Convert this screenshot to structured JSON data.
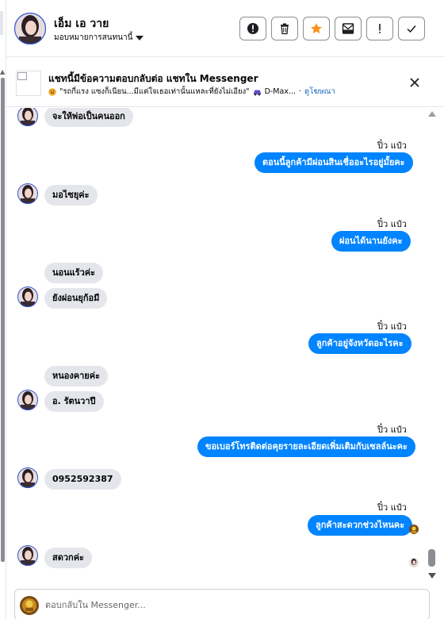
{
  "contact": {
    "name": "เอ็ม เอ วาย",
    "assign_label": "มอบหมายการสนทนานี้"
  },
  "toolbar": {
    "buttons": [
      {
        "icon": "alert-circle-icon",
        "name": "mark-spam-button"
      },
      {
        "icon": "trash-icon",
        "name": "delete-button"
      },
      {
        "icon": "star-icon",
        "name": "star-button",
        "color": "#f7931e"
      },
      {
        "icon": "envelope-icon",
        "name": "mark-unread-button"
      },
      {
        "icon": "exclamation-icon",
        "name": "follow-up-button"
      },
      {
        "icon": "check-icon",
        "name": "mark-done-button"
      }
    ]
  },
  "banner": {
    "title": "แชทนี้มีข้อความตอบกลับต่อ แชทใน Messenger",
    "quote": "\"รถกี่แรง แซงก็เนียน...มีแค่ใจเธอเท่านั้นแหละที่ยังไม่เอียง\"",
    "page": "D-Max...",
    "ad_label": "ดูโฆษณา"
  },
  "messages": [
    {
      "dir": "in",
      "text": "จะให้พ่อเป็นคนออก",
      "avatar": true
    },
    {
      "dir": "out",
      "sender": "ปิ๋ว แป๋ว",
      "text": "ตอนนี้ลูกค้ามีผ่อนสินเชื่ออะไรอยู่มั้ยคะ"
    },
    {
      "dir": "in",
      "text": "มอไซยุค่ะ",
      "avatar": true
    },
    {
      "dir": "out",
      "sender": "ปิ๋ว แป๋ว",
      "text": "ผ่อนได้นานยังคะ"
    },
    {
      "dir": "in",
      "text": "นอนแร้วค่ะ",
      "avatar": false
    },
    {
      "dir": "in",
      "text": "ยังผ่อนยุก้อมี",
      "avatar": true
    },
    {
      "dir": "out",
      "sender": "ปิ๋ว แป๋ว",
      "text": "ลูกค้าอยู่จังหวัดอะไรคะ"
    },
    {
      "dir": "in",
      "text": "หนองคายค่ะ",
      "avatar": false
    },
    {
      "dir": "in",
      "text": "อ. รัตนวาปี",
      "avatar": true
    },
    {
      "dir": "out",
      "sender": "ปิ๋ว แป๋ว",
      "text": "ขอเบอร์โทรติดต่อคุยรายละเอียดเพิ่มเติมกับเซลล์นะคะ"
    },
    {
      "dir": "in",
      "text": "0952592387",
      "avatar": true
    },
    {
      "dir": "out",
      "sender": "ปิ๋ว แป๋ว",
      "text": "ลูกค้าสะดวกช่วงไหนคะ"
    },
    {
      "dir": "in",
      "text": "สดวกค่ะ",
      "avatar": true
    }
  ],
  "composer": {
    "placeholder": "ตอบกลับใน Messenger..."
  },
  "colors": {
    "outgoing_bubble": "#0084ff",
    "incoming_bubble": "#e4e6eb",
    "link": "#1565c0"
  }
}
